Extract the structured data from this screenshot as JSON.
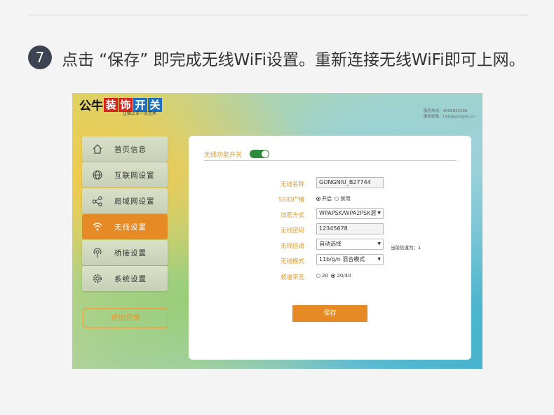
{
  "step": {
    "number": "7",
    "text": "点击 “保存” 即完成无线WiFi设置。重新连接无线WiFi即可上网。"
  },
  "brand": {
    "logo_plain": "公牛",
    "logo_chars": [
      "装",
      "饰",
      "开",
      "关"
    ],
    "slogan": "让插上多一点艺术",
    "contact_lines": [
      "服务热线：4008832388",
      "服务邮箱：heb@gongniu.cn"
    ]
  },
  "sidebar": {
    "items": [
      {
        "label": "首页信息",
        "icon": "home-icon"
      },
      {
        "label": "互联网设置",
        "icon": "globe-icon"
      },
      {
        "label": "局域网设置",
        "icon": "network-icon"
      },
      {
        "label": "无线设置",
        "icon": "wifi-icon",
        "active": true
      },
      {
        "label": "桥接设置",
        "icon": "bridge-icon"
      },
      {
        "label": "系统设置",
        "icon": "gear-icon"
      }
    ],
    "logout": "退出登录"
  },
  "form": {
    "switch_label": "无线功能开关",
    "switch_on": true,
    "ssid_label": "无线名称",
    "ssid_value": "GONGNIU_B27744",
    "broadcast_label": "SSID广播",
    "broadcast_on": "开启",
    "broadcast_off": "禁用",
    "encryption_label": "加密方式",
    "encryption_value": "WPAPSK/WPA2PSK混",
    "password_label": "无线密码",
    "password_value": "12345678",
    "channel_label": "无线信道",
    "channel_value": "自动选择",
    "current_channel": "当前信道为：1",
    "mode_label": "无线模式",
    "mode_value": "11b/g/n 混合模式",
    "bandwidth_label": "频道带宽",
    "bandwidth_opt1": "20",
    "bandwidth_opt2": "20/40",
    "save": "保存"
  },
  "colors": {
    "accent": "#e68a25",
    "toggle_on": "#2e8b3a",
    "step_circle": "#3d4350"
  }
}
